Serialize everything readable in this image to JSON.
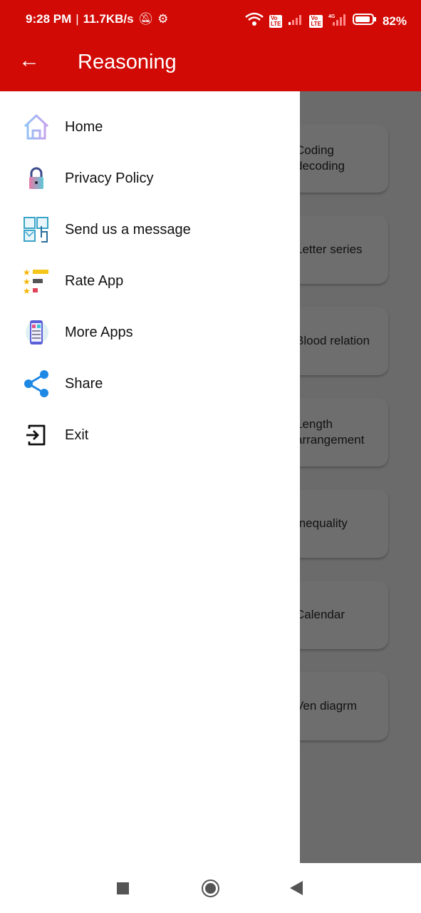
{
  "status_bar": {
    "time": "9:28 PM",
    "speed": "11.7KB/s",
    "battery": "82%",
    "icons": [
      "mute-bell-icon",
      "settings-icon",
      "wifi-icon",
      "volte-icon",
      "signal-icon",
      "battery-icon"
    ]
  },
  "app_bar": {
    "title": "Reasoning",
    "back_icon": "arrow-left-icon"
  },
  "colors": {
    "primary": "#d10a05",
    "scrim": "#6b6b6b"
  },
  "drawer": {
    "items": [
      {
        "label": "Home",
        "icon": "home-icon"
      },
      {
        "label": "Privacy Policy",
        "icon": "lock-icon"
      },
      {
        "label": "Send us a message",
        "icon": "contact-icon"
      },
      {
        "label": "Rate App",
        "icon": "rate-stars-icon"
      },
      {
        "label": "More Apps",
        "icon": "phone-apps-icon"
      },
      {
        "label": "Share",
        "icon": "share-icon"
      },
      {
        "label": "Exit",
        "icon": "exit-icon"
      }
    ]
  },
  "background_cards": [
    "Coding decoding",
    "Letter series",
    "Blood relation",
    "Length arrangement",
    "Inequality",
    "Calendar",
    "Ven diagrm"
  ]
}
